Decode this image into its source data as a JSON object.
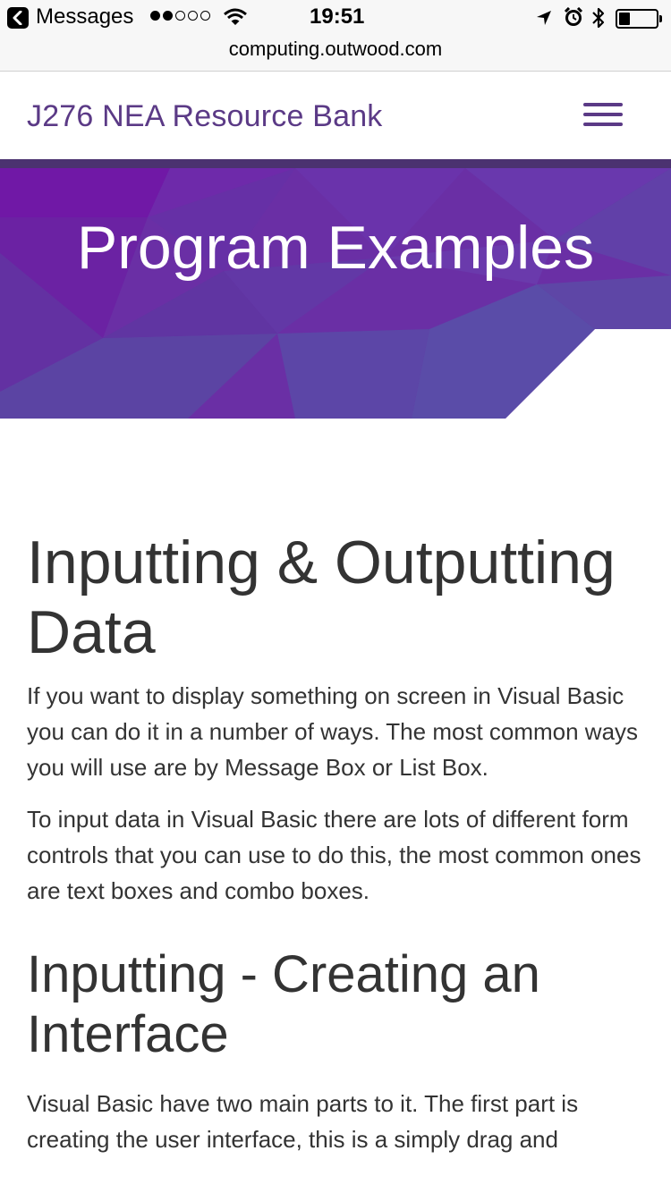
{
  "status_bar": {
    "back_app": "Messages",
    "time": "19:51",
    "signal_dots_filled": 2,
    "signal_dots_total": 5
  },
  "url_bar": {
    "url": "computing.outwood.com"
  },
  "header": {
    "site_title": "J276 NEA Resource Bank",
    "menu_icon": "hamburger-icon"
  },
  "hero": {
    "title": "Program Examples"
  },
  "content": {
    "section1": {
      "heading": "Inputting & Outputting Data",
      "paragraphs": [
        "If you want to display something on screen in Visual Basic you can do it in a number of ways. The most common ways you will use are by Message Box or List Box.",
        "To input data in Visual Basic there are lots of different form controls that you can use to do this, the most common ones are text boxes and combo boxes."
      ]
    },
    "section2": {
      "heading": "Inputting - Creating an Interface",
      "paragraphs": [
        "Visual Basic have two main parts to it. The first part is creating the user interface, this is a simply drag and"
      ]
    }
  },
  "colors": {
    "brand": "#5b3a86",
    "hero_dark": "#4b3270",
    "text": "#333333"
  }
}
